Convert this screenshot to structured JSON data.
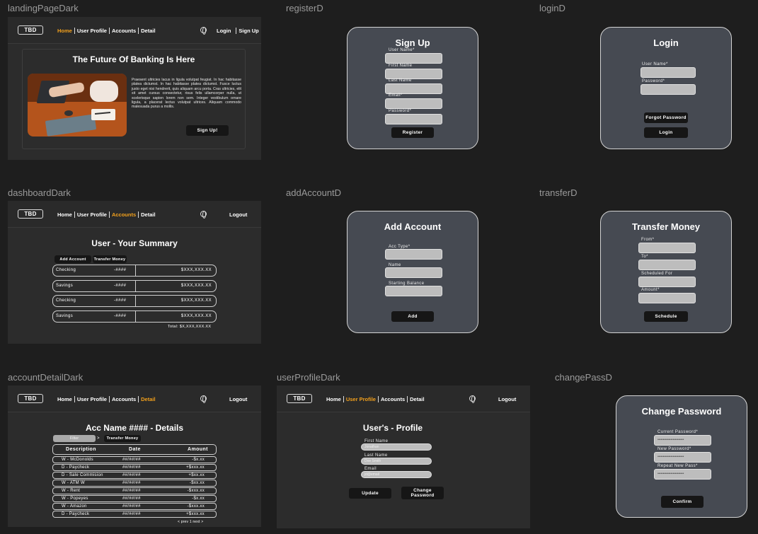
{
  "frames": {
    "landing": "landingPageDark",
    "register": "registerD",
    "login": "loginD",
    "dashboard": "dashboardDark",
    "addAccount": "addAccountD",
    "transfer": "transferD",
    "accountDetail": "accountDetailDark",
    "userProfile": "userProfileDark",
    "changePass": "changePassD"
  },
  "nav": {
    "logo": "TBD",
    "home": "Home",
    "profile": "User Profile",
    "accounts": "Accounts",
    "detail": "Detail",
    "login": "Login",
    "signup": "Sign Up",
    "logout": "Logout"
  },
  "landing": {
    "heading": "The Future Of Banking Is Here",
    "body": "Praesent ultricies lacus in ligula volutpat feugiat. In hac habitasse platea dictumst. In hac habitasse platea dictumst. Fusce luctus justo eget nisi hendrerit, quis aliquam arcu porta. Cras ultricies, elit sit amet cursus consectetur, risus felis ullamcorper nulla, ut scelerisque sapien lorem non sem. Integer vestibulum ornare ligula, a placerat lectus volutpat ultrices. Aliquam commodo malesuada purus a mollis.",
    "cta": "Sign Up!"
  },
  "register": {
    "title": "Sign Up",
    "username": "User Name*",
    "first": "First Name",
    "last": "Last Name",
    "email": "Email*",
    "password": "Password*",
    "submit": "Register"
  },
  "login": {
    "title": "Login",
    "username": "User Name*",
    "password": "Password*",
    "forgot": "Forgot Password",
    "submit": "Login"
  },
  "dashboard": {
    "title": "User - Your Summary",
    "addAccount": "Add Account",
    "transfer": "Transfer Money",
    "accounts": [
      {
        "name": "Checking",
        "number": "-####",
        "amount": "$XXX,XXX.XX"
      },
      {
        "name": "Savings",
        "number": "-####",
        "amount": "$XXX,XXX.XX"
      },
      {
        "name": "Checking",
        "number": "-####",
        "amount": "$XXX,XXX.XX"
      },
      {
        "name": "Savings",
        "number": "-####",
        "amount": "$XXX,XXX.XX"
      }
    ],
    "total": "Total: $X,XXX,XXX.XX"
  },
  "addAccount": {
    "title": "Add Account",
    "type": "Acc Type*",
    "name": "Name",
    "balance": "Starting Balance",
    "submit": "Add"
  },
  "transfer": {
    "title": "Transfer Money",
    "from": "From*",
    "to": "To*",
    "scheduled": "Scheduled For",
    "amount": "Amount*",
    "submit": "Schedule"
  },
  "detail": {
    "title": "Acc Name #### - Details",
    "filter": "Filter",
    "transfer": "Transfer Money",
    "headers": [
      "Description",
      "Date",
      "Amount"
    ],
    "rows": [
      {
        "desc": "W - McDonolds",
        "date": "##/##/##",
        "amt": "-$x.xx"
      },
      {
        "desc": "D - Paycheck",
        "date": "##/##/##",
        "amt": "+$xxx.xx"
      },
      {
        "desc": "D - Sale Commision",
        "date": "##/##/##",
        "amt": "+$xx.xx"
      },
      {
        "desc": "W - ATM W",
        "date": "##/##/##",
        "amt": "-$xx.xx"
      },
      {
        "desc": "W - Rent",
        "date": "##/##/##",
        "amt": "-$xxx.xx"
      },
      {
        "desc": "W - Popeyes",
        "date": "##/##/##",
        "amt": "-$x.xx"
      },
      {
        "desc": "W - Amazon",
        "date": "##/##/##",
        "amt": "-$xxx.xx"
      },
      {
        "desc": "D - Paycheck",
        "date": "##/##/##",
        "amt": "+$xxx.xx"
      }
    ],
    "pager": "< prev 1 next >"
  },
  "profile": {
    "title": "User's - Profile",
    "first": "First Name",
    "firstVal": "Jonathan",
    "last": "Last Name",
    "lastVal": "Doe Smith",
    "email": "Email",
    "emailVal": "jd@email",
    "update": "Update",
    "change": "Change Password"
  },
  "changePass": {
    "title": "Change Password",
    "current": "Current Password*",
    "new": "New Password*",
    "repeat": "Repeat New Pass*",
    "mask": "••••••••••••••••••••••••",
    "submit": "Confirm"
  }
}
